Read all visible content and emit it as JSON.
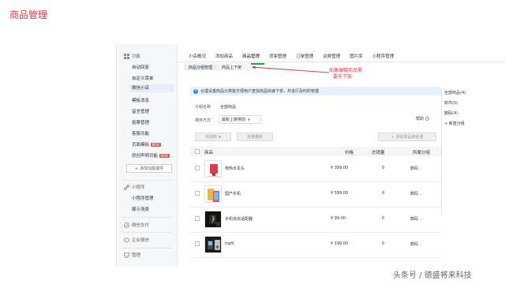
{
  "page_heading": "商品管理",
  "sidebar": {
    "group_function": "功能",
    "items": [
      {
        "label": "自动回复",
        "hot": false
      },
      {
        "label": "自定义菜单",
        "hot": false
      },
      {
        "label": "微信小店",
        "hot": false,
        "active": true
      },
      {
        "label": "模板消息",
        "hot": false
      },
      {
        "label": "留言管理",
        "hot": false
      },
      {
        "label": "投票管理",
        "hot": false
      },
      {
        "label": "客服功能",
        "hot": false
      },
      {
        "label": "页面模板",
        "hot": true
      },
      {
        "label": "原创声明功能",
        "hot": true
      }
    ],
    "hot_label": "NEW",
    "add_plugin": "添加功能插件",
    "group_miniapp": "小程序",
    "miniapp_items": [
      "小程序管理",
      "展示场景"
    ],
    "group_pay": "微信支付",
    "group_enterprise": "企业微信",
    "group_manage": "管理"
  },
  "top_tabs": [
    "小店概况",
    "添加商品",
    "商品管理",
    "货架管理",
    "订单管理",
    "运费管理",
    "图片库",
    "小程序管理"
  ],
  "sub_tabs": [
    "商品分组管理",
    "商品上下架"
  ],
  "annotation": {
    "line1": "如果编辑商品需",
    "line2": "要先下架"
  },
  "notice": "合理设置商品分类能方便用户查找商品快速下单，并进行及时的管理",
  "category_label": "分组名称",
  "category_value": "全部商品",
  "sort_label": "排序方式",
  "sort_value": "最新上架排前",
  "help": "帮助",
  "btn_add_to": "添加到",
  "btn_batch": "批量删除",
  "btn_add_new": "添加商品到此组",
  "table": {
    "headers": {
      "product": "商品",
      "price": "价格",
      "stock": "总销量",
      "group": "所属分组"
    },
    "rows": [
      {
        "name": "电热水龙头",
        "price": "¥ 399.00",
        "stock": "0",
        "group": "数码"
      },
      {
        "name": "国产手机",
        "price": "¥ 599.00",
        "stock": "0",
        "group": "数码"
      },
      {
        "name": "手机快充适配器",
        "price": "¥ 99.00",
        "stock": "0",
        "group": "数码"
      },
      {
        "name": "mp9",
        "price": "¥ 199.00",
        "stock": "0",
        "group": "数码"
      }
    ]
  },
  "right_panel": [
    "全部商品(4)",
    "软件(0)",
    "数码(4)",
    "+ 新建分组"
  ],
  "watermark": "头条号 / 德盛将来科技",
  "colors": {
    "accent_green": "#1aad19",
    "annotation_red": "#d6394a",
    "info_blue": "#2f87e2"
  }
}
